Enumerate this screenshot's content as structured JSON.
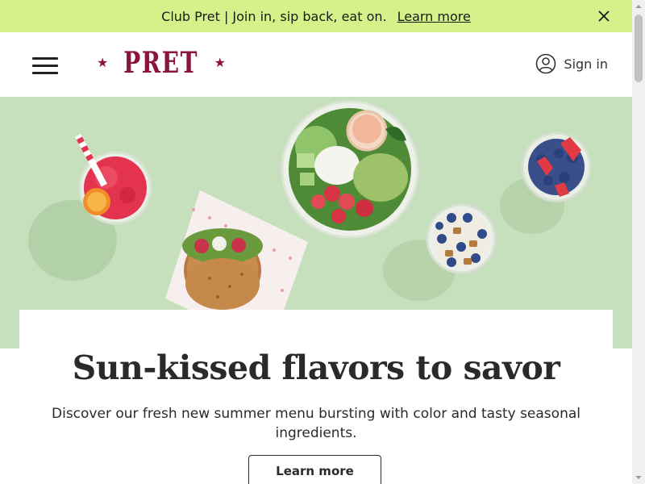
{
  "announcement": {
    "message": "Club Pret | Join in, sip back, eat on.",
    "link_label": "Learn more"
  },
  "header": {
    "logo_text": "PRET",
    "logo_star": "★",
    "signin_label": "Sign in"
  },
  "hero": {
    "image_alt": "Summer menu: berry drink, salad bowl, sandwich, berry cups"
  },
  "promo": {
    "title": "Sun-kissed flavors to savor",
    "description": "Discover our fresh new summer menu bursting with color and tasty seasonal ingredients.",
    "button_label": "Learn more"
  },
  "colors": {
    "announcement_bg": "#d5f28a",
    "brand": "#8b1538",
    "hero_bg": "#c6dfbd"
  },
  "icons": {
    "close": "close-icon",
    "menu": "hamburger-menu-icon",
    "account": "user-circle-icon"
  }
}
